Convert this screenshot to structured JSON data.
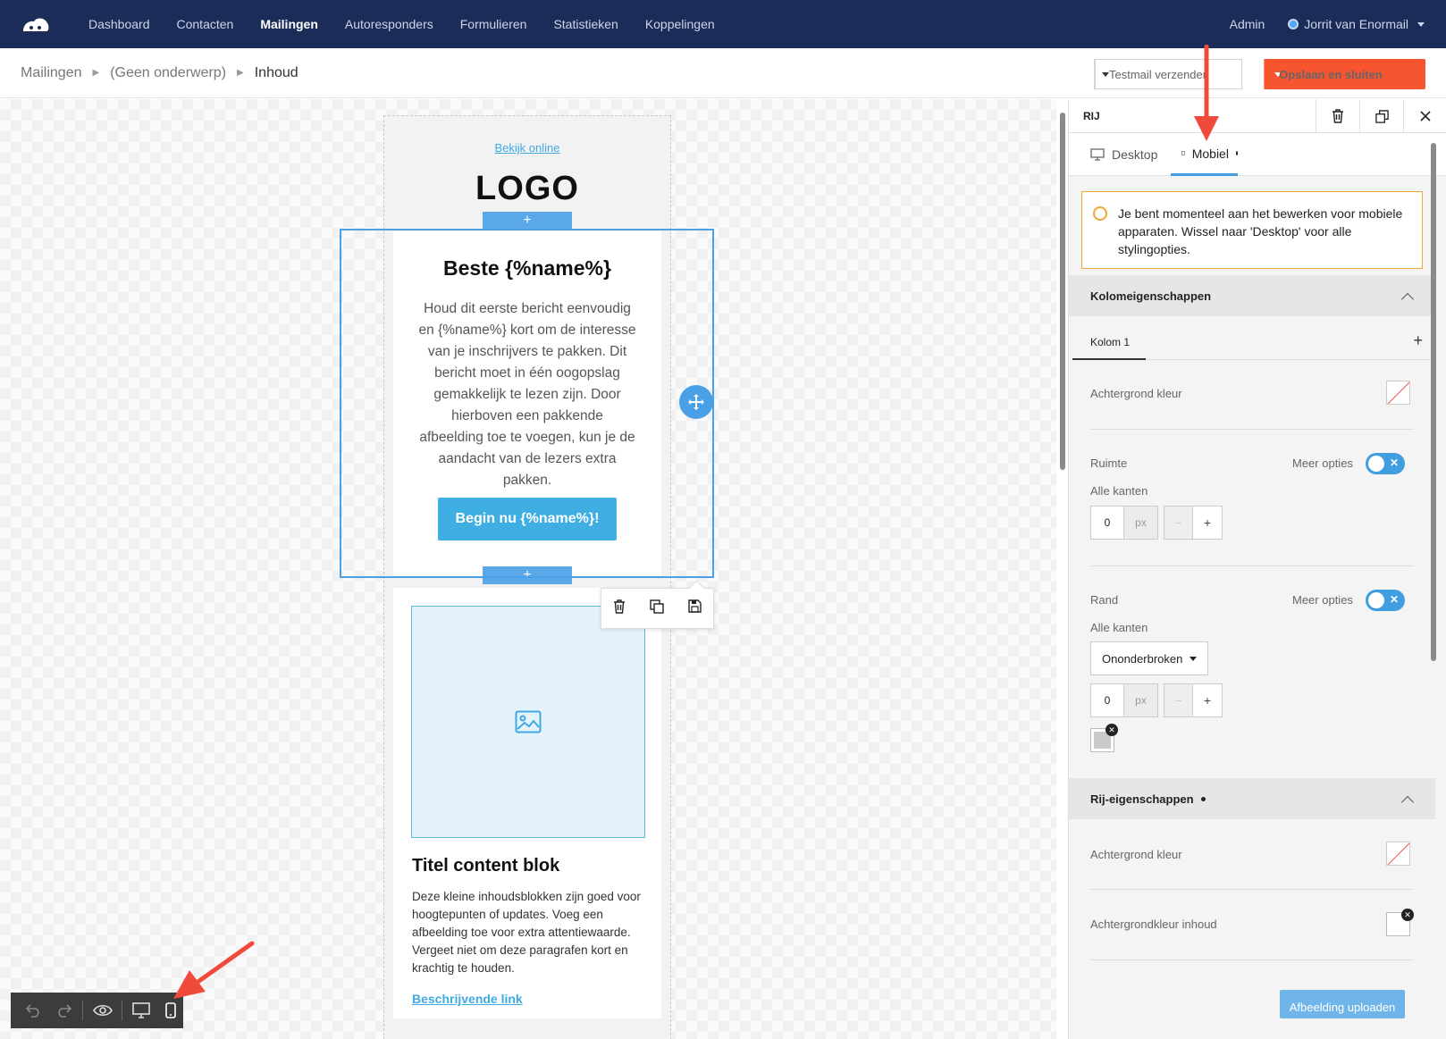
{
  "nav": {
    "items": [
      "Dashboard",
      "Contacten",
      "Mailingen",
      "Autoresponders",
      "Formulieren",
      "Statistieken",
      "Koppelingen"
    ],
    "active": "Mailingen",
    "admin": "Admin",
    "user": "Jorrit van Enormail"
  },
  "breadcrumb": {
    "items": [
      "Mailingen",
      "(Geen onderwerp)",
      "Inhoud"
    ]
  },
  "toolbar": {
    "testmail_label": "Testmail verzenden",
    "save_label": "Opslaan en sluiten"
  },
  "email": {
    "view_online": "Bekijk online",
    "logo": "LOGO",
    "heading": "Beste {%name%}",
    "paragraph": "Houd dit eerste bericht eenvoudig en {%name%} kort om de interesse van je inschrijvers te pakken. Dit bericht moet in één oogopslag gemakkelijk te lezen zijn. Door hierboven een pakkende afbeelding toe te voegen, kun je de aandacht van de lezers extra pakken.",
    "cta": "Begin nu {%name%}!",
    "block_title": "Titel content blok",
    "block_text": "Deze kleine inhoudsblokken zijn goed voor hoogtepunten of updates. Voeg een afbeelding toe voor extra attentiewaarde. Vergeet niet om deze paragrafen kort en krachtig te houden.",
    "block_link": "Beschrijvende link",
    "add_symbol": "+"
  },
  "panel": {
    "title": "RIJ",
    "tabs": {
      "desktop": "Desktop",
      "mobile": "Mobiel"
    },
    "warning": "Je bent momenteel aan het bewerken voor mobiele apparaten. Wissel naar 'Desktop' voor alle stylingopties.",
    "column_section": "Kolomeigenschappen",
    "column_tab": "Kolom 1",
    "bg_color_label": "Achtergrond kleur",
    "space_label": "Ruimte",
    "more_options": "Meer opties",
    "all_sides": "Alle kanten",
    "space_value": "0",
    "unit": "px",
    "border_label": "Rand",
    "border_style": "Ononderbroken",
    "border_value": "0",
    "row_section": "Rij-eigenschappen",
    "row_bg_label": "Achtergrond kleur",
    "row_content_bg_label": "Achtergrondkleur inhoud",
    "upload_label": "Afbeelding uploaden"
  },
  "colors": {
    "nav_bg": "#1b2c59",
    "accent": "#3f9de0",
    "save_button": "#f7552f",
    "cta": "#3eaee3",
    "warning_border": "#f0a733",
    "annotation_arrow": "#f04a3c"
  }
}
